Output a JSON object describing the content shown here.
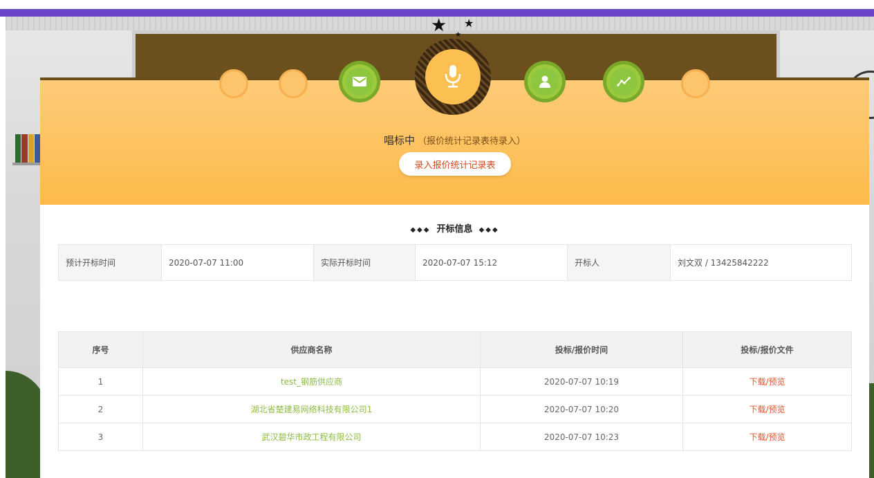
{
  "status": {
    "title": "唱标中",
    "subtitle": "（报价统计记录表待录入）",
    "button_label": "录入报价统计记录表"
  },
  "progress_icons": [
    "mail-icon",
    "microphone-icon",
    "user-icon",
    "chart-line-icon"
  ],
  "open_info": {
    "section_title": "开标信息",
    "planned_label": "预计开标时间",
    "planned_value": "2020-07-07 11:00",
    "actual_label": "实际开标时间",
    "actual_value": "2020-07-07 15:12",
    "opener_label": "开标人",
    "opener_value": "刘文双 / 13425842222"
  },
  "bids": {
    "headers": [
      "序号",
      "供应商名称",
      "投标/报价时间",
      "投标/报价文件"
    ],
    "rows": [
      {
        "index": "1",
        "supplier": "test_钢筋供应商",
        "time": "2020-07-07 10:19",
        "file": "下载/预览"
      },
      {
        "index": "2",
        "supplier": "湖北省楚建易网络科技有限公司1",
        "time": "2020-07-07 10:20",
        "file": "下载/预览"
      },
      {
        "index": "3",
        "supplier": "武汉碧华市政工程有限公司",
        "time": "2020-07-07 10:23",
        "file": "下载/预览"
      }
    ]
  },
  "colors": {
    "accent_purple": "#6a44c9",
    "hero_orange": "#fdba4a",
    "step_green": "#8dc63f",
    "link_green": "#8dbb46",
    "link_red": "#e2532a"
  }
}
